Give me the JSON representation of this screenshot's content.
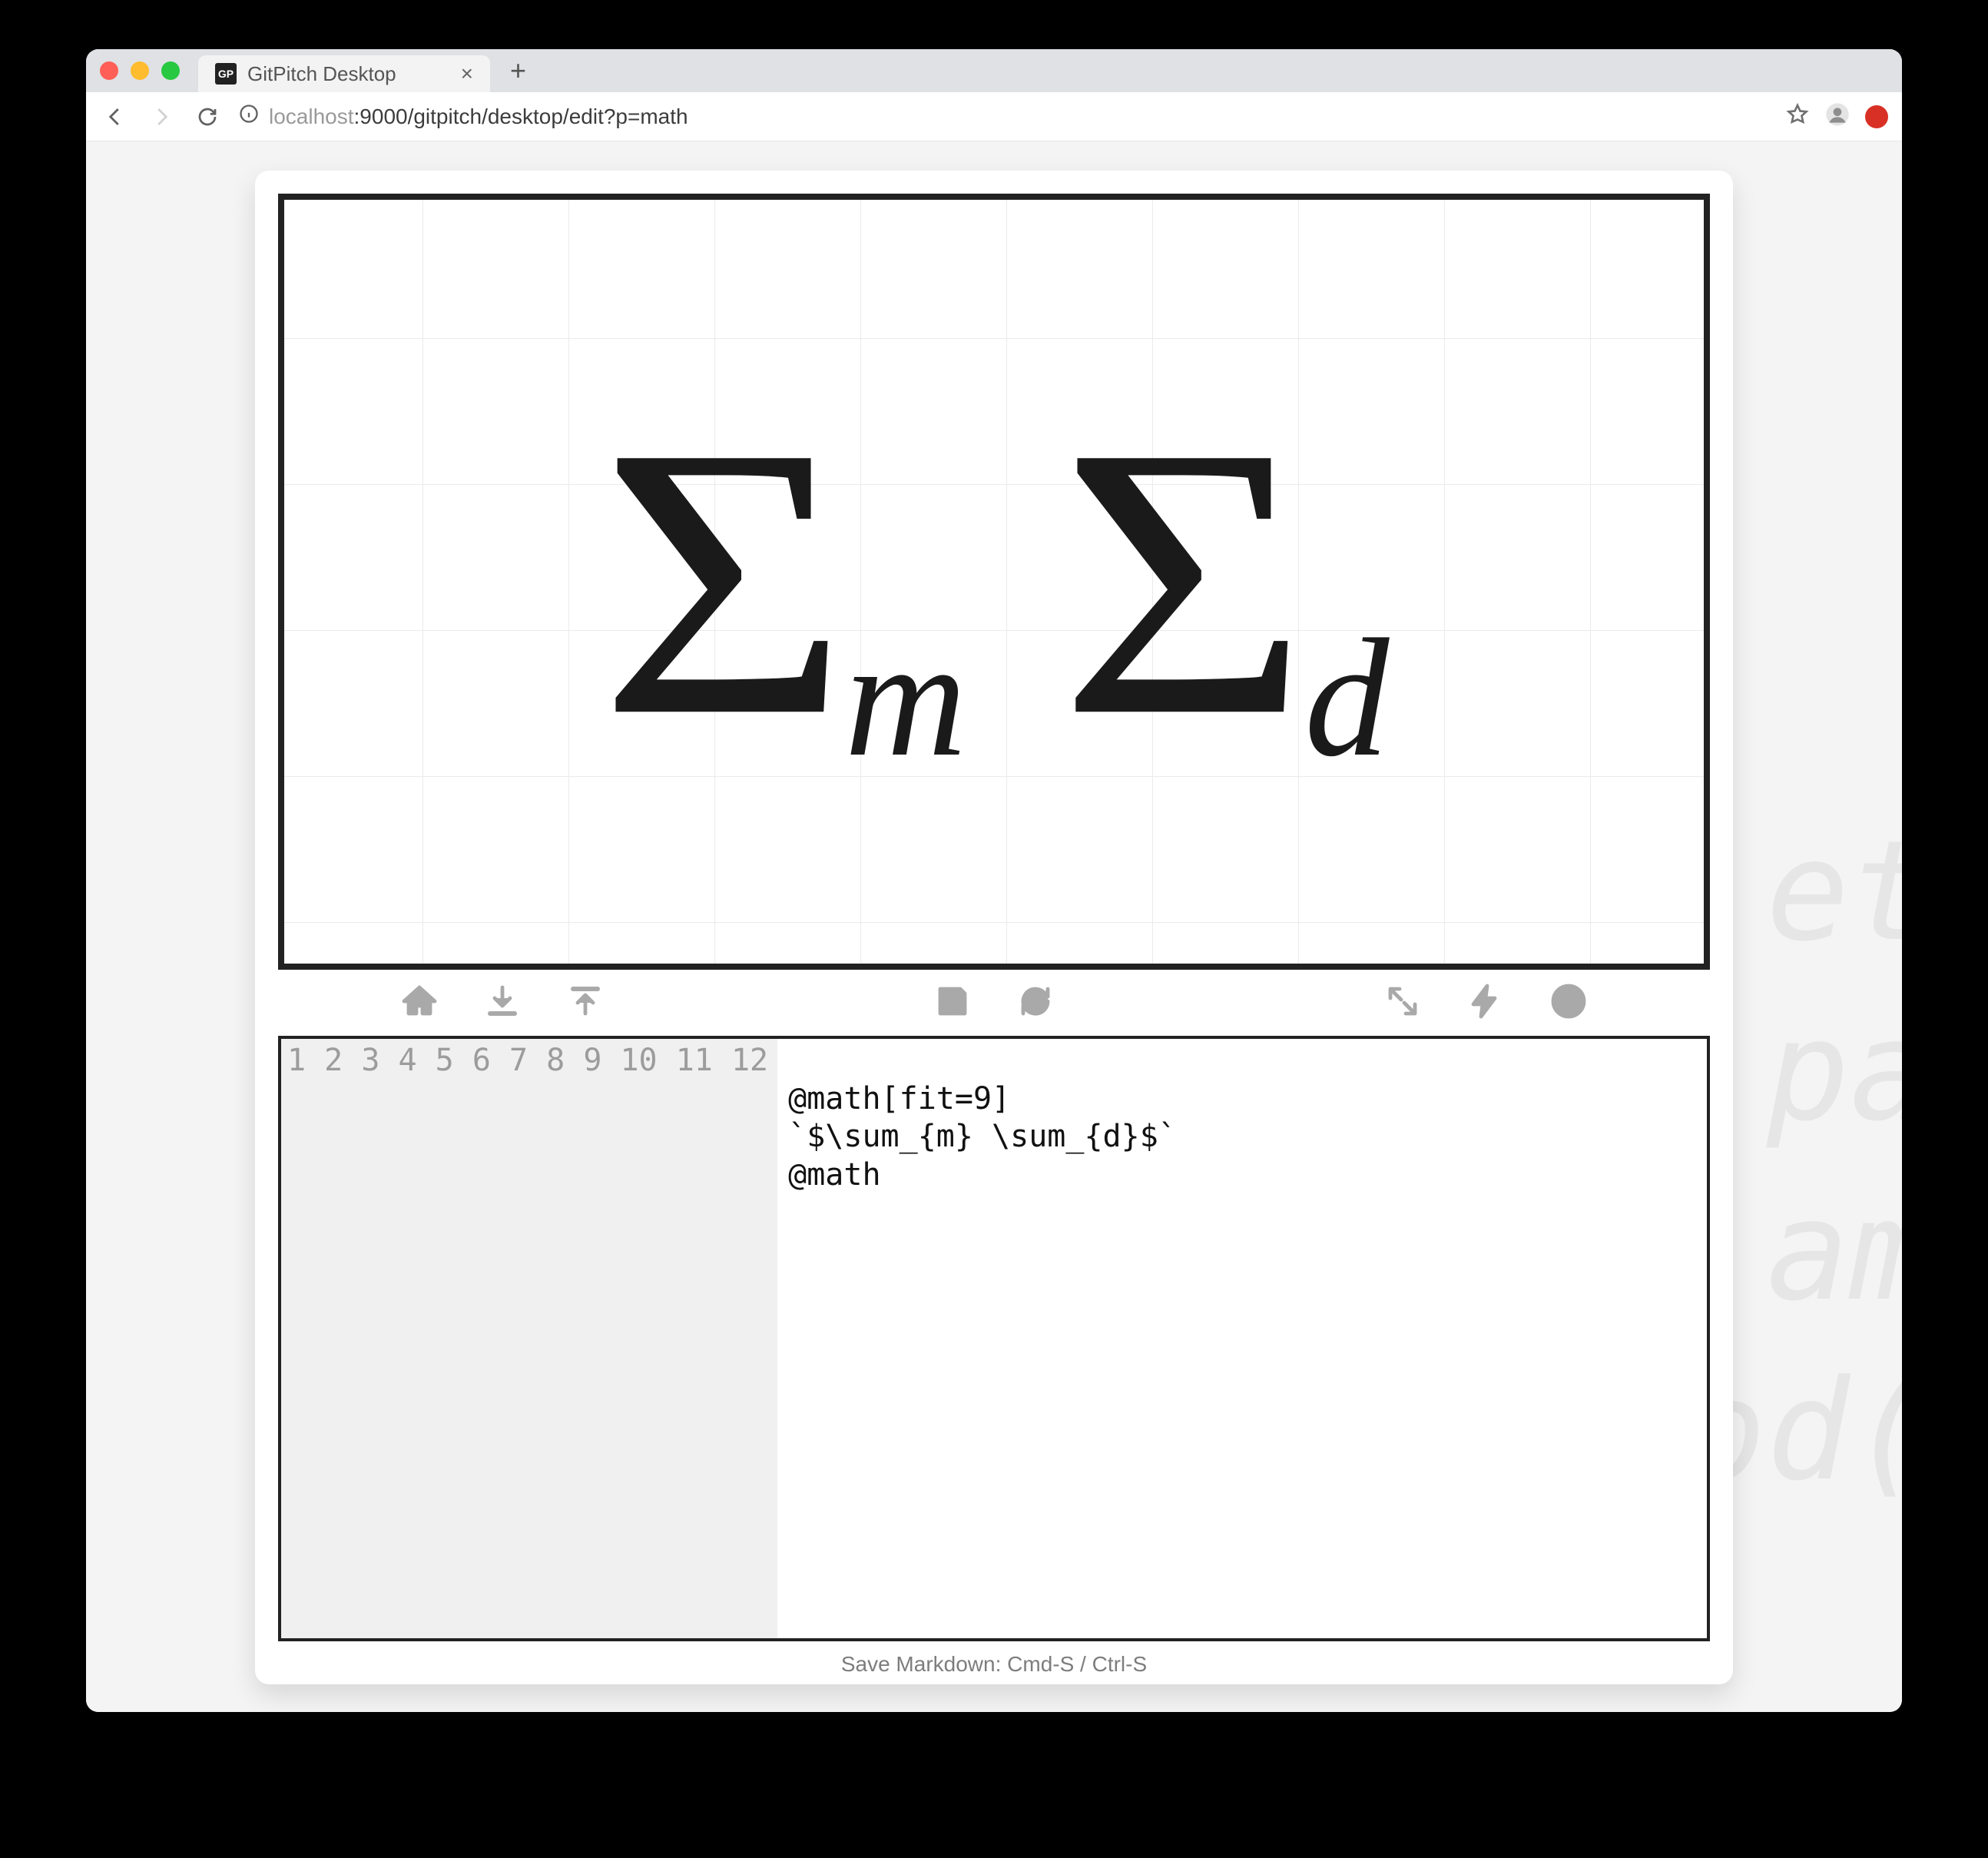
{
  "browser": {
    "tab_title": "GitPitch Desktop",
    "favicon_text": "GP",
    "url_host_muted": "localhost",
    "url_rest": ":9000/gitpitch/desktop/edit?p=math"
  },
  "background_code_lines": [
    "et",
    "pa",
    "'am",
    "od("
  ],
  "preview": {
    "terms": [
      {
        "symbol": "Σ",
        "subscript": "m"
      },
      {
        "symbol": "Σ",
        "subscript": "d"
      }
    ]
  },
  "toolbar": {
    "left": [
      "home-icon",
      "download-icon",
      "upload-icon"
    ],
    "center": [
      "save-icon",
      "refresh-icon"
    ],
    "right": [
      "expand-icon",
      "bolt-icon",
      "help-icon"
    ]
  },
  "editor": {
    "line_count": 12,
    "lines": [
      "",
      "@math[fit=9]",
      "`$\\sum_{m} \\sum_{d}$`",
      "@math",
      "",
      "",
      "",
      "",
      "",
      "",
      "",
      ""
    ]
  },
  "statusbar": "Save Markdown: Cmd-S / Ctrl-S"
}
